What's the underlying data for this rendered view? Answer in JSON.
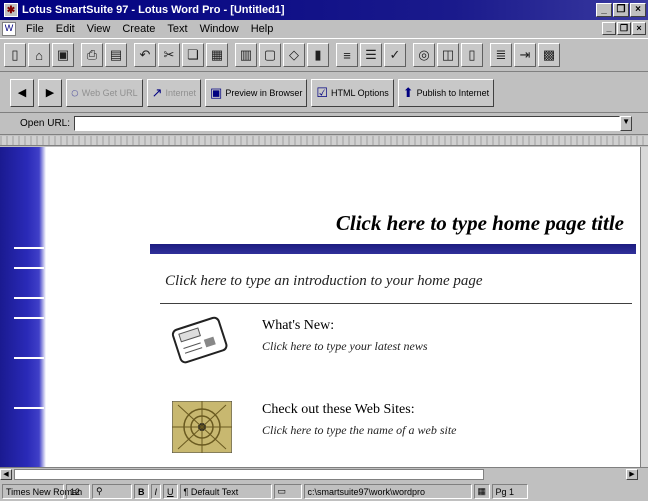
{
  "window": {
    "title": "Lotus SmartSuite 97  -  Lotus Word Pro - [Untitled1]"
  },
  "menu": {
    "items": [
      "File",
      "Edit",
      "View",
      "Create",
      "Text",
      "Window",
      "Help"
    ]
  },
  "smarticons": [
    "new-document-icon",
    "open-icon",
    "save-icon",
    "print-icon",
    "print-preview-icon",
    "undo-icon",
    "cut-icon",
    "copy-icon",
    "paste-icon",
    "table-icon",
    "frame-icon",
    "draw-icon",
    "chart-icon",
    "bullets-icon",
    "outline-icon",
    "spell-icon",
    "zoom-icon",
    "frame-layout-icon",
    "columns-icon",
    "align-icon",
    "indent-icon",
    "image-icon"
  ],
  "webbar": {
    "back": "◀",
    "forward": "▶",
    "get_url": "Web Get URL",
    "internet": "Internet",
    "preview": "Preview in Browser",
    "html_options": "HTML Options",
    "publish": "Publish to Internet"
  },
  "url": {
    "label": "Open URL:",
    "value": ""
  },
  "document": {
    "home_title": "Click here to type home page title",
    "intro": "Click here to type an introduction to your home page",
    "sections": [
      {
        "heading": "What's New:",
        "subtext": "Click here to type your latest news"
      },
      {
        "heading": "Check out these Web Sites:",
        "subtext": "Click here to type the name of a web site"
      }
    ]
  },
  "status": {
    "font": "Times New Roman",
    "size": "12",
    "style": "Default Text",
    "path": "c:\\smartsuite97\\work\\wordpro",
    "page": "Pg 1"
  },
  "colors": {
    "title_bar": "#000080",
    "accent_band": "#1c1c80"
  }
}
